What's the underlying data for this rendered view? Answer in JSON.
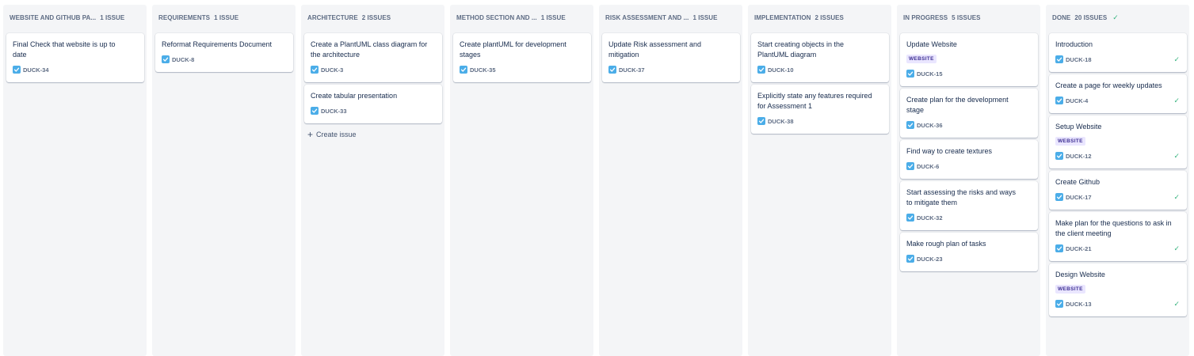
{
  "columns": [
    {
      "id": "website",
      "title": "WEBSITE AND GITHUB PA...",
      "count": "1 ISSUE",
      "cards": [
        {
          "summary": "Final Check that website is up to date",
          "key": "DUCK-34",
          "label": null
        }
      ]
    },
    {
      "id": "requirements",
      "title": "REQUIREMENTS",
      "count": "1 ISSUE",
      "cards": [
        {
          "summary": "Reformat Requirements Document",
          "key": "DUCK-8",
          "label": null
        }
      ]
    },
    {
      "id": "architecture",
      "title": "ARCHITECTURE",
      "count": "2 ISSUES",
      "cards": [
        {
          "summary": "Create a PlantUML class diagram for the architecture",
          "key": "DUCK-3",
          "label": null
        },
        {
          "summary": "Create tabular presentation",
          "key": "DUCK-33",
          "label": null
        }
      ],
      "create_issue": "Create issue"
    },
    {
      "id": "method",
      "title": "METHOD SECTION AND ...",
      "count": "1 ISSUE",
      "cards": [
        {
          "summary": "Create plantUML for development stages",
          "key": "DUCK-35",
          "label": null
        }
      ]
    },
    {
      "id": "risk",
      "title": "RISK ASSESSMENT AND ...",
      "count": "1 ISSUE",
      "cards": [
        {
          "summary": "Update Risk assessment and mitigation",
          "key": "DUCK-37",
          "label": null
        }
      ]
    },
    {
      "id": "implementation",
      "title": "IMPLEMENTATION",
      "count": "2 ISSUES",
      "cards": [
        {
          "summary": "Start creating objects in the PlantUML diagram",
          "key": "DUCK-10",
          "label": null
        },
        {
          "summary": "Explicitly state any features required for Assessment 1",
          "key": "DUCK-38",
          "label": null
        }
      ]
    },
    {
      "id": "inprogress",
      "title": "IN PROGRESS",
      "count": "5 ISSUES",
      "cards": [
        {
          "summary": "Update Website",
          "key": "DUCK-15",
          "label": "WEBSITE"
        },
        {
          "summary": "Create plan for the development stage",
          "key": "DUCK-36",
          "label": null
        },
        {
          "summary": "Find way to create textures",
          "key": "DUCK-6",
          "label": null
        },
        {
          "summary": "Start assessing the risks and ways to mitigate them",
          "key": "DUCK-32",
          "label": null
        },
        {
          "summary": "Make rough plan of tasks",
          "key": "DUCK-23",
          "label": null
        }
      ]
    },
    {
      "id": "done",
      "title": "DONE",
      "count": "20 ISSUES",
      "header_check": "✓",
      "cards": [
        {
          "summary": "Introduction",
          "key": "DUCK-18",
          "label": null,
          "done": true
        },
        {
          "summary": "Create a page for weekly updates",
          "key": "DUCK-4",
          "label": null,
          "done": true
        },
        {
          "summary": "Setup Website",
          "key": "DUCK-12",
          "label": "WEBSITE",
          "done": true
        },
        {
          "summary": "Create Github",
          "key": "DUCK-17",
          "label": null,
          "done": true
        },
        {
          "summary": "Make plan for the questions to ask in the client meeting",
          "key": "DUCK-21",
          "label": null,
          "done": true
        },
        {
          "summary": "Design Website",
          "key": "DUCK-13",
          "label": "WEBSITE",
          "done": true
        }
      ]
    }
  ],
  "icons": {
    "issue_type": "task-checkbox-icon",
    "done": "checkmark-icon",
    "create": "plus-icon"
  },
  "colors": {
    "column_bg": "#f4f5f7",
    "task_icon": "#4bade8",
    "done_check": "#36b37e",
    "label_bg": "#eae6ff",
    "label_text": "#403294"
  }
}
